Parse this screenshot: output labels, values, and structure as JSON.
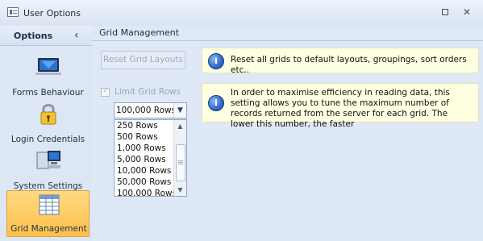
{
  "window": {
    "title": "User Options"
  },
  "sidebar": {
    "title": "Options",
    "items": [
      {
        "label": "Forms Behaviour"
      },
      {
        "label": "Login Credentials"
      },
      {
        "label": "System Settings"
      },
      {
        "label": "Grid Management"
      }
    ]
  },
  "content": {
    "section_title": "Grid Management",
    "reset_button": "Reset Grid Layouts",
    "reset_info": "Reset all grids to default layouts, groupings, sort orders etc..",
    "limit_label": "Limit Grid Rows",
    "limit_info": "In order to maximise efficiency in reading data, this setting allows you to tune the maximum number of records returned from the server for each grid. The lower this number, the faster",
    "selected_rows": "100,000 Rows",
    "options": [
      "250 Rows",
      "500 Rows",
      "1,000 Rows",
      "5,000 Rows",
      "10,000 Rows",
      "50,000 Rows",
      "100,000 Rows"
    ]
  },
  "icons": {
    "app": "options-window-icon",
    "restore": "restore-icon",
    "close": "close-icon",
    "collapse": "chevron-left-icon",
    "info": "info-icon"
  },
  "colors": {
    "window": "#dfe8f6",
    "selected": "#ffc14a",
    "info_box": "#ffffe1"
  }
}
